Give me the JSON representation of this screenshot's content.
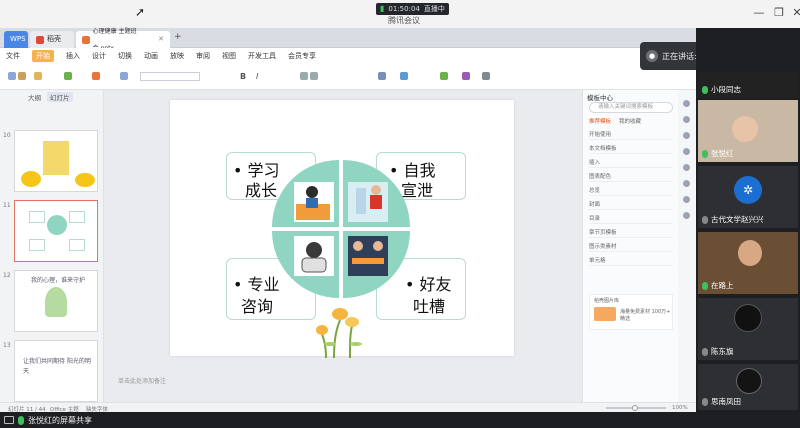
{
  "meeting": {
    "title": "腾讯会议",
    "timer": "01:50:04",
    "live_label": "直播中",
    "speaking_label": "正在讲话: 张悦红;",
    "share_label": "张悦红的屏幕共享"
  },
  "wps": {
    "tabs": [
      {
        "label": "WPS"
      },
      {
        "label": "稻壳"
      },
      {
        "label": "心理健康 主题班会.pptx"
      }
    ],
    "menu": [
      "文件",
      "开始",
      "插入",
      "设计",
      "切换",
      "动画",
      "放映",
      "审阅",
      "视图",
      "开发工具",
      "会员专享"
    ],
    "active_menu": "开始",
    "thumb_tabs": [
      "大纲",
      "幻灯片"
    ],
    "thumbnails": [
      {
        "num": "10"
      },
      {
        "num": "11"
      },
      {
        "num": "12",
        "text": "我的心理，谁来守护"
      },
      {
        "num": "13",
        "text": "让我们共同期待 阳光的明天"
      }
    ],
    "note_placeholder": "单击此处添加备注",
    "status": {
      "slide": "幻灯片 11 / 44",
      "theme": "Office 主题",
      "font": "缺失字体",
      "zoom": "100%"
    }
  },
  "slide": {
    "quadrants": [
      {
        "lines": [
          "• 学习",
          "成长"
        ]
      },
      {
        "lines": [
          "• 自我",
          "宣泄"
        ]
      },
      {
        "lines": [
          "• 专业",
          "咨询"
        ]
      },
      {
        "lines": [
          "• 好友",
          "吐槽"
        ]
      }
    ],
    "colors": {
      "accent": "#8fd5c2",
      "border": "#b7dcd2",
      "orange": "#f29b3b",
      "blue": "#2f6db3"
    }
  },
  "right_panel": {
    "title": "模板中心",
    "search_placeholder": "请输入关键词搜索模板",
    "tabs": [
      "推荐模板",
      "我的收藏"
    ],
    "items": [
      "开始使用",
      "本文档模板",
      "插入",
      "图表配色",
      "总览",
      "封面",
      "目录",
      "章节页模板",
      "图示类素材",
      "单元格"
    ],
    "promo_title": "稻壳图片库",
    "promo_text": "海量免费素材 100万+ 精选"
  },
  "participants": [
    {
      "name": "小段同志"
    },
    {
      "name": "张悦红"
    },
    {
      "name": "古代文学赵兴兴"
    },
    {
      "name": "在路上"
    },
    {
      "name": "陈东旗"
    },
    {
      "name": "思南凤田"
    }
  ]
}
